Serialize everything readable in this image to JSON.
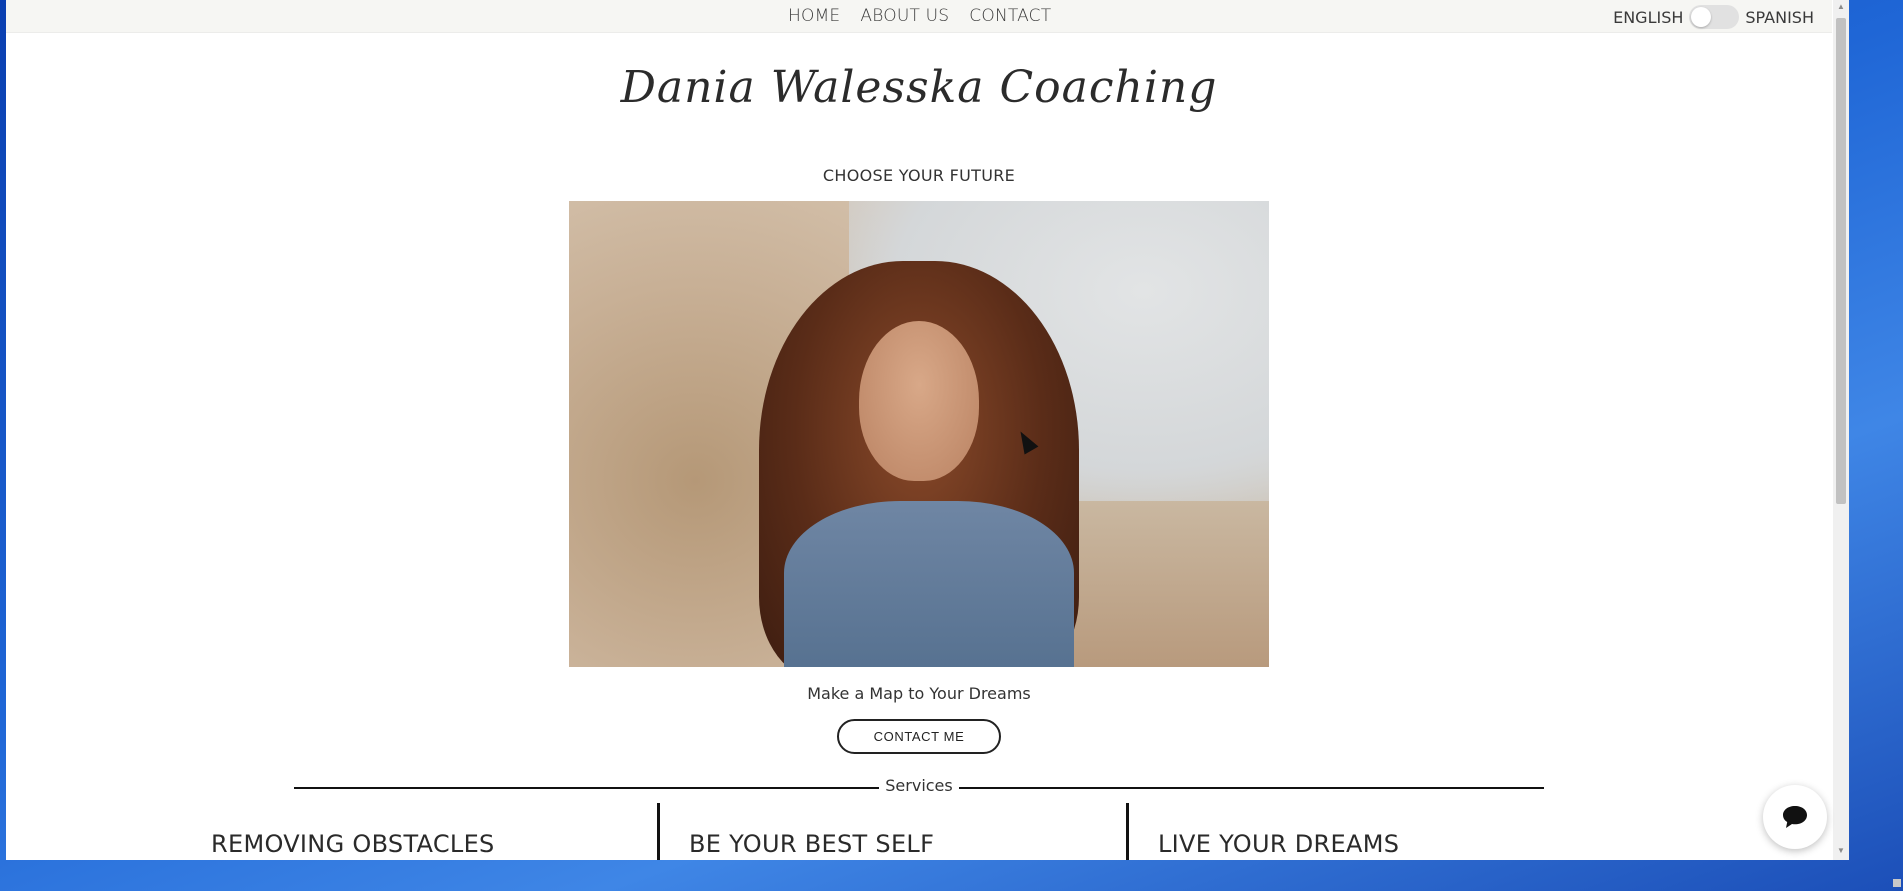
{
  "nav": {
    "items": [
      {
        "label": "HOME"
      },
      {
        "label": "ABOUT US"
      },
      {
        "label": "CONTACT"
      }
    ]
  },
  "language": {
    "left": "ENGLISH",
    "right": "SPANISH"
  },
  "brand": {
    "logo_text": "Dania Walesska Coaching"
  },
  "hero": {
    "tagline": "CHOOSE YOUR FUTURE",
    "subline": "Make a Map to Your Dreams",
    "cta_label": "CONTACT ME"
  },
  "services": {
    "label": "Services",
    "titles": [
      "REMOVING OBSTACLES",
      "BE YOUR BEST SELF",
      "LIVE YOUR DREAMS"
    ]
  },
  "icons": {
    "chat": "chat-bubble-icon",
    "cursor": "mouse-cursor-icon"
  }
}
